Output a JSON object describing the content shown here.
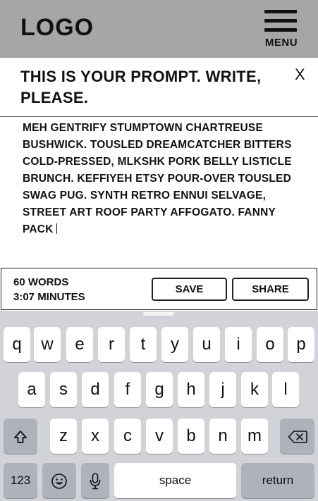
{
  "header": {
    "logo": "LOGO",
    "menu_label": "MENU"
  },
  "prompt": {
    "title": "THIS IS YOUR PROMPT. WRITE, PLEASE.",
    "close": "X"
  },
  "editor": {
    "text": "MEH GENTRIFY STUMPTOWN CHARTREUSE BUSHWICK. TOUSLED DREAMCATCHER BITTERS COLD-PRESSED, MLKSHK PORK BELLY LISTICLE BRUNCH. KEFFIYEH ETSY POUR-OVER TOUSLED SWAG PUG. SYNTH RETRO ENNUI SELVAGE, STREET ART ROOF PARTY AFFOGATO. FANNY PACK"
  },
  "stats": {
    "words": "60 WORDS",
    "time": "3:07 MINUTES"
  },
  "actions": {
    "save": "SAVE",
    "share": "SHARE"
  },
  "keyboard": {
    "row1": [
      "q",
      "w",
      "e",
      "r",
      "t",
      "y",
      "u",
      "i",
      "o",
      "p"
    ],
    "row2": [
      "a",
      "s",
      "d",
      "f",
      "g",
      "h",
      "j",
      "k",
      "l"
    ],
    "row3": [
      "z",
      "x",
      "c",
      "v",
      "b",
      "n",
      "m"
    ],
    "numbers": "123",
    "space": "space",
    "return": "return",
    "icons": {
      "shift": "shift-icon",
      "backspace": "backspace-icon",
      "emoji": "emoji-icon",
      "mic": "microphone-icon"
    }
  }
}
